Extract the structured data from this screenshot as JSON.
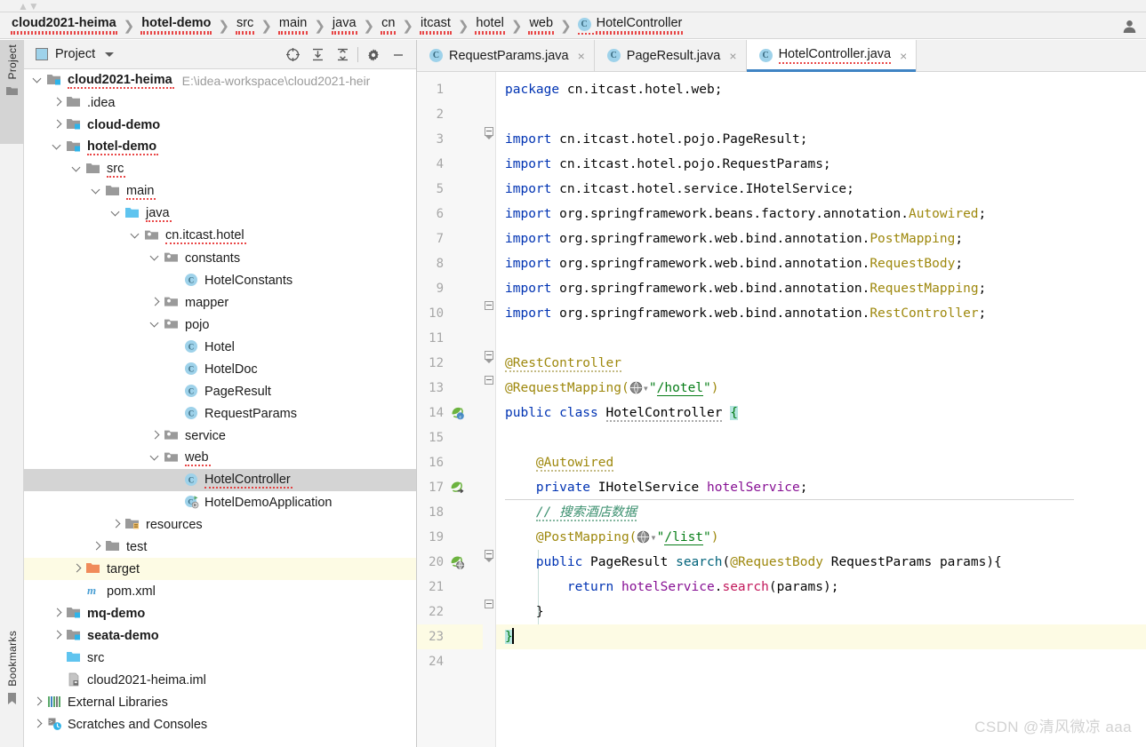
{
  "window": {
    "user_icon": "user-icon"
  },
  "breadcrumb": {
    "items": [
      {
        "label": "cloud2021-heima",
        "bold": true,
        "squiggly": true,
        "icon": null
      },
      {
        "label": "hotel-demo",
        "bold": true,
        "squiggly": true,
        "icon": null
      },
      {
        "label": "src",
        "bold": false,
        "squiggly": true,
        "icon": null
      },
      {
        "label": "main",
        "bold": false,
        "squiggly": true,
        "icon": null
      },
      {
        "label": "java",
        "bold": false,
        "squiggly": true,
        "icon": null
      },
      {
        "label": "cn",
        "bold": false,
        "squiggly": true,
        "icon": null
      },
      {
        "label": "itcast",
        "bold": false,
        "squiggly": true,
        "icon": null
      },
      {
        "label": "hotel",
        "bold": false,
        "squiggly": true,
        "icon": null
      },
      {
        "label": "web",
        "bold": false,
        "squiggly": true,
        "icon": null
      },
      {
        "label": "HotelController",
        "bold": false,
        "squiggly": true,
        "icon": "class-icon"
      }
    ],
    "separator": "❯"
  },
  "tool_strip": {
    "tabs": [
      {
        "label": "Project",
        "icon": "folder-icon",
        "active": true
      },
      {
        "label": "Bookmarks",
        "icon": "bookmark-icon",
        "active": false
      }
    ]
  },
  "project_panel": {
    "title": "Project",
    "caret": "chevron-down-icon",
    "toolbar": [
      {
        "name": "select-opened-file-icon",
        "tooltip": "Select Opened File"
      },
      {
        "name": "expand-all-icon",
        "tooltip": "Expand All"
      },
      {
        "name": "collapse-all-icon",
        "tooltip": "Collapse All"
      },
      {
        "name": "settings-gear-icon",
        "tooltip": "Settings"
      },
      {
        "name": "hide-icon",
        "tooltip": "Hide"
      }
    ],
    "tree": [
      {
        "label": "cloud2021-heima",
        "indent": 0,
        "arrow": "down",
        "icon": "module-folder-icon",
        "bold": true,
        "squiggly": true,
        "selected": false,
        "highlight": false,
        "note": "E:\\idea-workspace\\cloud2021-heir"
      },
      {
        "label": ".idea",
        "indent": 1,
        "arrow": "right",
        "icon": "folder-icon",
        "bold": false,
        "squiggly": false,
        "selected": false,
        "highlight": false,
        "note": ""
      },
      {
        "label": "cloud-demo",
        "indent": 1,
        "arrow": "right",
        "icon": "module-folder-icon",
        "bold": true,
        "squiggly": false,
        "selected": false,
        "highlight": false,
        "note": ""
      },
      {
        "label": "hotel-demo",
        "indent": 1,
        "arrow": "down",
        "icon": "module-folder-icon",
        "bold": true,
        "squiggly": true,
        "selected": false,
        "highlight": false,
        "note": ""
      },
      {
        "label": "src",
        "indent": 2,
        "arrow": "down",
        "icon": "folder-icon",
        "bold": false,
        "squiggly": true,
        "selected": false,
        "highlight": false,
        "note": ""
      },
      {
        "label": "main",
        "indent": 3,
        "arrow": "down",
        "icon": "folder-icon",
        "bold": false,
        "squiggly": true,
        "selected": false,
        "highlight": false,
        "note": ""
      },
      {
        "label": "java",
        "indent": 4,
        "arrow": "down",
        "icon": "source-root-icon",
        "bold": false,
        "squiggly": true,
        "selected": false,
        "highlight": false,
        "note": ""
      },
      {
        "label": "cn.itcast.hotel",
        "indent": 5,
        "arrow": "down",
        "icon": "package-icon",
        "bold": false,
        "squiggly": true,
        "selected": false,
        "highlight": false,
        "note": ""
      },
      {
        "label": "constants",
        "indent": 6,
        "arrow": "down",
        "icon": "package-icon",
        "bold": false,
        "squiggly": false,
        "selected": false,
        "highlight": false,
        "note": ""
      },
      {
        "label": "HotelConstants",
        "indent": 7,
        "arrow": "none",
        "icon": "class-icon",
        "bold": false,
        "squiggly": false,
        "selected": false,
        "highlight": false,
        "note": ""
      },
      {
        "label": "mapper",
        "indent": 6,
        "arrow": "right",
        "icon": "package-icon",
        "bold": false,
        "squiggly": false,
        "selected": false,
        "highlight": false,
        "note": ""
      },
      {
        "label": "pojo",
        "indent": 6,
        "arrow": "down",
        "icon": "package-icon",
        "bold": false,
        "squiggly": false,
        "selected": false,
        "highlight": false,
        "note": ""
      },
      {
        "label": "Hotel",
        "indent": 7,
        "arrow": "none",
        "icon": "class-icon",
        "bold": false,
        "squiggly": false,
        "selected": false,
        "highlight": false,
        "note": ""
      },
      {
        "label": "HotelDoc",
        "indent": 7,
        "arrow": "none",
        "icon": "class-icon",
        "bold": false,
        "squiggly": false,
        "selected": false,
        "highlight": false,
        "note": ""
      },
      {
        "label": "PageResult",
        "indent": 7,
        "arrow": "none",
        "icon": "class-icon",
        "bold": false,
        "squiggly": false,
        "selected": false,
        "highlight": false,
        "note": ""
      },
      {
        "label": "RequestParams",
        "indent": 7,
        "arrow": "none",
        "icon": "class-icon",
        "bold": false,
        "squiggly": false,
        "selected": false,
        "highlight": false,
        "note": ""
      },
      {
        "label": "service",
        "indent": 6,
        "arrow": "right",
        "icon": "package-icon",
        "bold": false,
        "squiggly": false,
        "selected": false,
        "highlight": false,
        "note": ""
      },
      {
        "label": "web",
        "indent": 6,
        "arrow": "down",
        "icon": "package-icon",
        "bold": false,
        "squiggly": true,
        "selected": false,
        "highlight": false,
        "note": ""
      },
      {
        "label": "HotelController",
        "indent": 7,
        "arrow": "none",
        "icon": "class-icon",
        "bold": false,
        "squiggly": true,
        "selected": true,
        "highlight": false,
        "note": ""
      },
      {
        "label": "HotelDemoApplication",
        "indent": 7,
        "arrow": "none",
        "icon": "runnable-class-icon",
        "bold": false,
        "squiggly": false,
        "selected": false,
        "highlight": false,
        "note": ""
      },
      {
        "label": "resources",
        "indent": 4,
        "arrow": "right",
        "icon": "resource-root-icon",
        "bold": false,
        "squiggly": false,
        "selected": false,
        "highlight": false,
        "note": ""
      },
      {
        "label": "test",
        "indent": 3,
        "arrow": "right",
        "icon": "folder-icon",
        "bold": false,
        "squiggly": false,
        "selected": false,
        "highlight": false,
        "note": ""
      },
      {
        "label": "target",
        "indent": 2,
        "arrow": "right",
        "icon": "excluded-folder-icon",
        "bold": false,
        "squiggly": false,
        "selected": false,
        "highlight": true,
        "note": ""
      },
      {
        "label": "pom.xml",
        "indent": 2,
        "arrow": "none",
        "icon": "maven-file-icon",
        "bold": false,
        "squiggly": false,
        "selected": false,
        "highlight": false,
        "note": ""
      },
      {
        "label": "mq-demo",
        "indent": 1,
        "arrow": "right",
        "icon": "module-folder-icon",
        "bold": true,
        "squiggly": false,
        "selected": false,
        "highlight": false,
        "note": ""
      },
      {
        "label": "seata-demo",
        "indent": 1,
        "arrow": "right",
        "icon": "module-folder-icon",
        "bold": true,
        "squiggly": false,
        "selected": false,
        "highlight": false,
        "note": ""
      },
      {
        "label": "src",
        "indent": 1,
        "arrow": "none",
        "icon": "source-root-icon",
        "bold": false,
        "squiggly": false,
        "selected": false,
        "highlight": false,
        "note": ""
      },
      {
        "label": "cloud2021-heima.iml",
        "indent": 1,
        "arrow": "none",
        "icon": "iml-file-icon",
        "bold": false,
        "squiggly": false,
        "selected": false,
        "highlight": false,
        "note": ""
      },
      {
        "label": "External Libraries",
        "indent": 0,
        "arrow": "right",
        "icon": "libraries-icon",
        "bold": false,
        "squiggly": false,
        "selected": false,
        "highlight": false,
        "note": ""
      },
      {
        "label": "Scratches and Consoles",
        "indent": 0,
        "arrow": "right",
        "icon": "scratches-icon",
        "bold": false,
        "squiggly": false,
        "selected": false,
        "highlight": false,
        "note": ""
      }
    ]
  },
  "editor": {
    "tabs": [
      {
        "label": "RequestParams.java",
        "icon": "class-icon",
        "active": false,
        "close": "×"
      },
      {
        "label": "PageResult.java",
        "icon": "class-icon",
        "active": false,
        "close": "×"
      },
      {
        "label": "HotelController.java",
        "icon": "class-icon",
        "active": true,
        "close": "×"
      }
    ],
    "line_numbers": [
      1,
      2,
      3,
      4,
      5,
      6,
      7,
      8,
      9,
      10,
      11,
      12,
      13,
      14,
      15,
      16,
      17,
      18,
      19,
      20,
      21,
      22,
      23,
      24
    ],
    "current_line": 23,
    "gutter_marks": [
      {
        "line": 14,
        "icon": "spring-bean-gutter-icon"
      },
      {
        "line": 17,
        "icon": "spring-autowired-gutter-icon"
      },
      {
        "line": 20,
        "icon": "spring-mapping-gutter-icon"
      }
    ],
    "code_lines": [
      "package cn.itcast.hotel.web;",
      "",
      "import cn.itcast.hotel.pojo.PageResult;",
      "import cn.itcast.hotel.pojo.RequestParams;",
      "import cn.itcast.hotel.service.IHotelService;",
      "import org.springframework.beans.factory.annotation.Autowired;",
      "import org.springframework.web.bind.annotation.PostMapping;",
      "import org.springframework.web.bind.annotation.RequestBody;",
      "import org.springframework.web.bind.annotation.RequestMapping;",
      "import org.springframework.web.bind.annotation.RestController;",
      "",
      "@RestController",
      "@RequestMapping(\"/hotel\")",
      "public class HotelController {",
      "",
      "    @Autowired",
      "    private IHotelService hotelService;",
      "    // 搜索酒店数据",
      "    @PostMapping(\"/list\")",
      "    public PageResult search(@RequestBody RequestParams params){",
      "        return hotelService.search(params);",
      "    }",
      "}",
      ""
    ]
  },
  "watermark": "CSDN @清风微凉 aaa",
  "colors": {
    "accent": "#3f84c4",
    "keyword": "#0033b3",
    "annotation": "#9e880d",
    "string": "#067d17",
    "field": "#871094",
    "method": "#00627a",
    "call": "#c2185b",
    "comment": "#3a8f6e",
    "selection": "#b6e5e0",
    "current_line": "#fdfbe4",
    "tree_selection": "#d4d4d4",
    "class_icon": "#9ed2ea"
  }
}
